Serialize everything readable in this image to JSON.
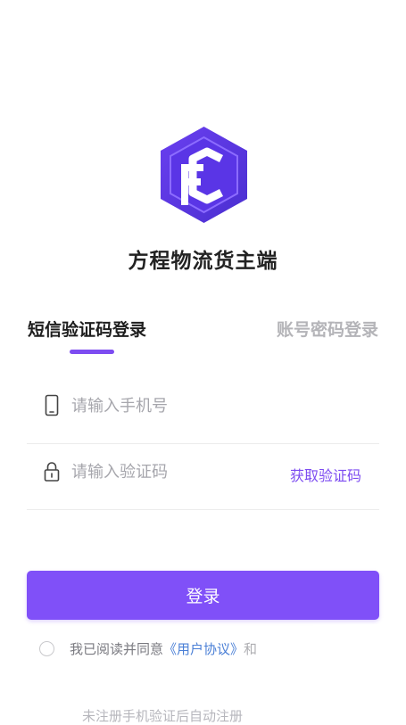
{
  "app": {
    "logo_text": "FC",
    "title": "方程物流货主端"
  },
  "tabs": [
    {
      "label": "短信验证码登录",
      "active": true
    },
    {
      "label": "账号密码登录",
      "active": false
    }
  ],
  "form": {
    "phone": {
      "icon": "phone-icon",
      "placeholder": "请输入手机号",
      "value": ""
    },
    "code": {
      "icon": "lock-icon",
      "placeholder": "请输入验证码",
      "value": "",
      "get_code_label": "获取验证码"
    }
  },
  "login_button": {
    "label": "登录"
  },
  "agreement": {
    "checked": false,
    "prefix": "我已阅读并同意",
    "link": "《用户协议》",
    "suffix": "和"
  },
  "footer_note": "未注册手机验证后自动注册",
  "colors": {
    "accent": "#7d4cf1",
    "button": "#8050f8",
    "link": "#4a7fd6",
    "placeholder": "#a6a6ac",
    "inactive_tab": "#b4b4b8"
  }
}
